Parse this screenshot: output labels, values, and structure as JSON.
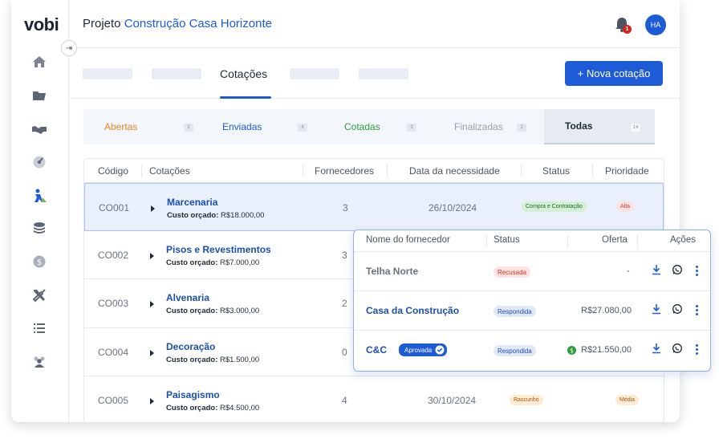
{
  "app": {
    "logo": "vobi"
  },
  "header": {
    "project_prefix": "Projeto",
    "project_name": "Construção Casa Horizonte",
    "notifications_count": "1",
    "avatar_initials": "HA"
  },
  "nav": {
    "active_tab": "Cotações",
    "new_button": "+ Nova cotação"
  },
  "sidebar": {
    "items": [
      "home-icon",
      "folder-icon",
      "handshake-icon",
      "dashboard-icon",
      "worker-icon",
      "coins-icon",
      "dollar-icon",
      "tools-icon",
      "list-icon",
      "team-icon"
    ]
  },
  "filters": [
    {
      "label": "Abertas",
      "count": "2",
      "color": "#e8862a"
    },
    {
      "label": "Enviadas",
      "count": "4",
      "color": "#1e5bd6"
    },
    {
      "label": "Cotadas",
      "count": "3",
      "color": "#2e9c3d"
    },
    {
      "label": "Finalizadas",
      "count": "2",
      "color": "#9aa1ad"
    },
    {
      "label": "Todas",
      "count": "14",
      "color": "#1f2a37"
    }
  ],
  "table": {
    "headers": [
      "Código",
      "Cotações",
      "Fornecedores",
      "Data da necessidade",
      "Status",
      "Prioridade"
    ],
    "budget_prefix": "Custo orçado:",
    "rows": [
      {
        "code": "CO001",
        "name": "Marcenaria",
        "budget": "R$18.000,00",
        "suppliers": "3",
        "date": "26/10/2024",
        "status": "Compra e Contratação",
        "priority": "Alta"
      },
      {
        "code": "CO002",
        "name": "Pisos e Revestimentos",
        "budget": "R$7.000,00",
        "suppliers": "3",
        "date": "",
        "status": "",
        "priority": ""
      },
      {
        "code": "CO003",
        "name": "Alvenaria",
        "budget": "R$3.000,00",
        "suppliers": "2",
        "date": "",
        "status": "",
        "priority": ""
      },
      {
        "code": "CO004",
        "name": "Decoração",
        "budget": "R$1.500,00",
        "suppliers": "0",
        "date": "",
        "status": "",
        "priority": ""
      },
      {
        "code": "CO005",
        "name": "Paisagismo",
        "budget": "R$4.500,00",
        "suppliers": "4",
        "date": "30/10/2024",
        "status": "Rascunho",
        "priority": "Média"
      }
    ]
  },
  "suppliers_popup": {
    "headers": [
      "Nome do fornecedor",
      "Status",
      "Oferta",
      "Ações"
    ],
    "rows": [
      {
        "name": "Telha Norte",
        "status": "Recusada",
        "offer": "-",
        "approved": ""
      },
      {
        "name": "Casa da Construção",
        "status": "Respondida",
        "offer": "R$27.080,00",
        "approved": ""
      },
      {
        "name": "C&C",
        "status": "Respondida",
        "offer": "R$21.550,00",
        "approved": "Aprovada"
      }
    ]
  },
  "colors": {
    "primary": "#1e5bd6",
    "status_purchase_bg": "#d4f0d4",
    "priority_high_bg": "#fde2e2",
    "draft_bg": "#fdebd3"
  }
}
